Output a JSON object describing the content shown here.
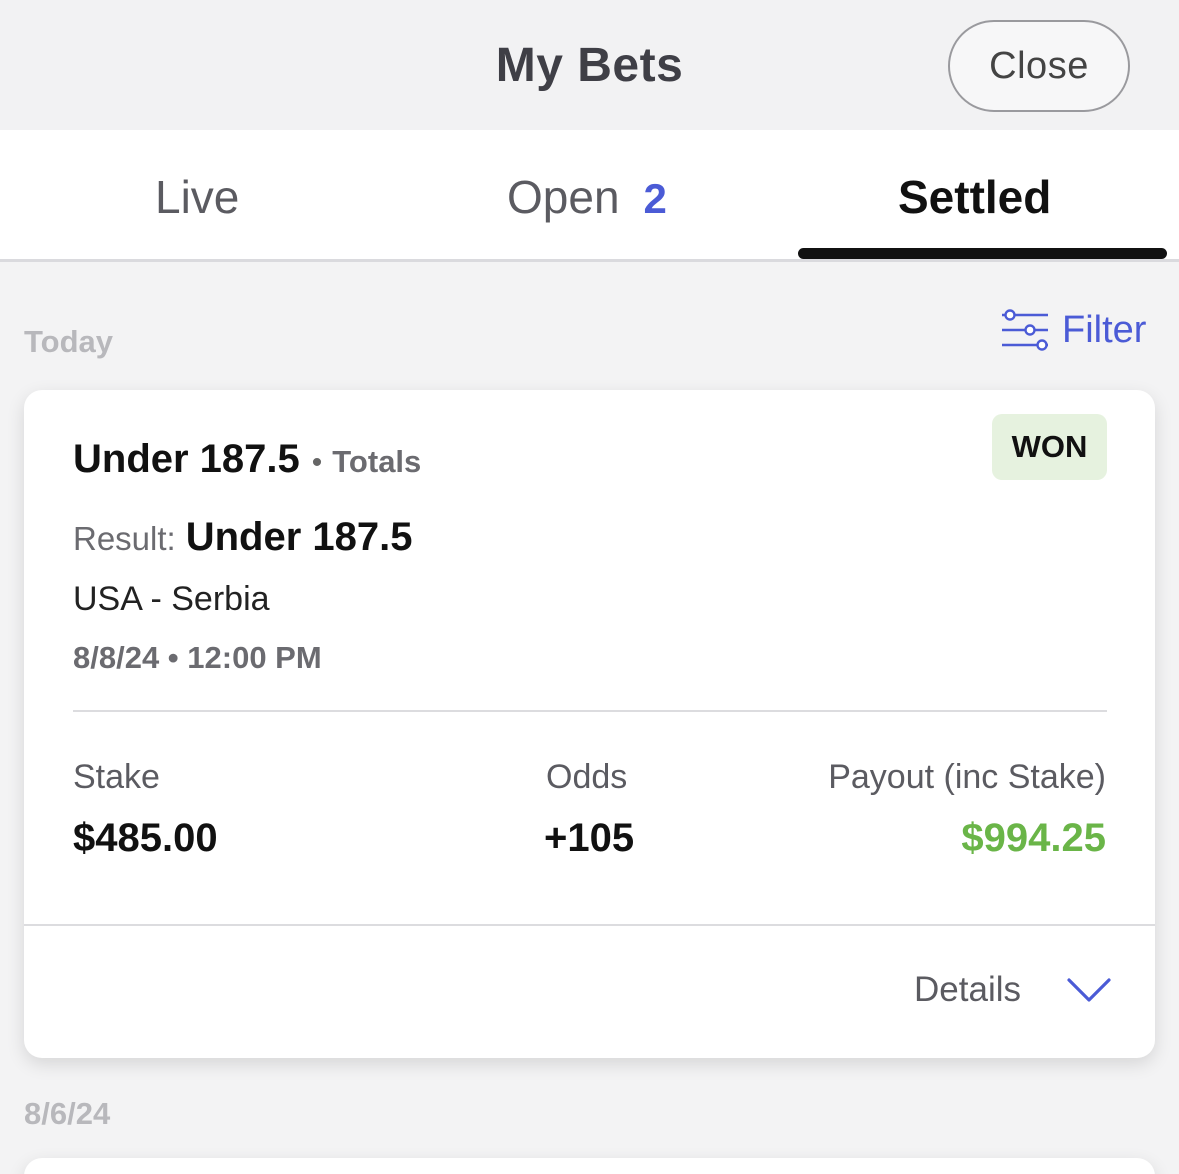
{
  "header": {
    "title": "My Bets",
    "close_label": "Close"
  },
  "tabs": [
    {
      "label": "Live"
    },
    {
      "label": "Open",
      "count": "2"
    },
    {
      "label": "Settled",
      "active": true
    }
  ],
  "filter": {
    "label": "Filter",
    "icon": "sliders-icon"
  },
  "sections": [
    {
      "date_label": "Today",
      "bets": [
        {
          "selection": "Under 187.5",
          "market": "Totals",
          "status": "WON",
          "result_label": "Result:",
          "result_value": "Under 187.5",
          "event": "USA - Serbia",
          "datetime": "8/8/24 • 12:00 PM",
          "stake_label": "Stake",
          "stake": "$485.00",
          "odds_label": "Odds",
          "odds": "+105",
          "payout_label": "Payout (inc Stake)",
          "payout": "$994.25",
          "details_label": "Details"
        }
      ]
    },
    {
      "date_label": "8/6/24"
    }
  ],
  "colors": {
    "accent": "#4b5bd6",
    "won_green": "#6ab548",
    "won_badge_bg": "#e6f2df"
  }
}
